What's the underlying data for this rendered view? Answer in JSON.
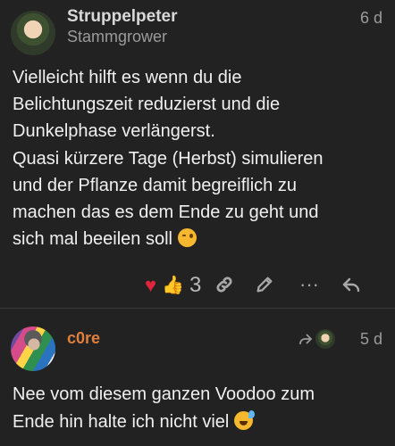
{
  "post1": {
    "username": "Struppelpeter",
    "subtitle": "Stammgrower",
    "date": "6 d",
    "lines": [
      "Vielleicht hilft es wenn du die",
      "Belichtungszeit reduzierst und die",
      "Dunkelphase verlängerst.",
      "Quasi kürzere Tage (Herbst) simulieren",
      "und der Pflanze damit begreiflich zu",
      "machen das es dem Ende zu geht und",
      "sich mal beeilen soll"
    ],
    "like_count": "3"
  },
  "post2": {
    "username": "c0re",
    "date": "5 d",
    "lines": [
      "Nee vom diesem ganzen Voodoo zum",
      "Ende hin halte ich nicht viel"
    ]
  },
  "icons": {
    "heart": "heart-icon",
    "thumbs_up": "thumbs-up-icon",
    "link": "link-icon",
    "edit": "pencil-icon",
    "more": "ellipsis-icon",
    "reply": "reply-icon",
    "reply_to": "reply-to-icon"
  },
  "colors": {
    "background": "#222222",
    "username2": "#e07f3d",
    "heart": "#e0243b"
  }
}
